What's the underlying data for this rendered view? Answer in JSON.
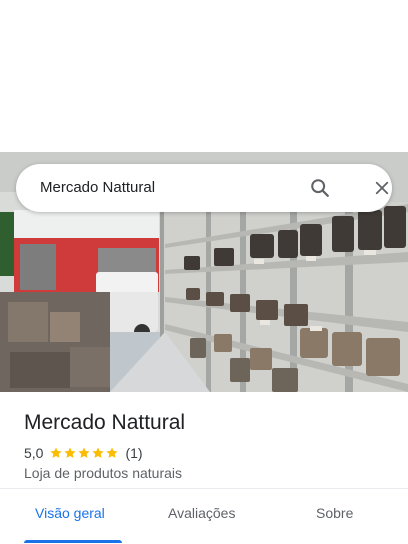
{
  "search": {
    "query": "Mercado Nattural"
  },
  "place": {
    "name": "Mercado Nattural",
    "rating": "5,0",
    "stars": 5,
    "review_count": "(1)",
    "category": "Loja de produtos naturais"
  },
  "tabs": [
    {
      "label": "Visão geral",
      "active": true
    },
    {
      "label": "Avaliações",
      "active": false
    },
    {
      "label": "Sobre",
      "active": false
    }
  ],
  "colors": {
    "accent": "#1a73e8",
    "star": "#fbbc04",
    "text_primary": "#202124",
    "text_secondary": "#5f6368"
  },
  "icons": {
    "search": "search-icon",
    "close": "close-icon",
    "star": "star-icon"
  }
}
